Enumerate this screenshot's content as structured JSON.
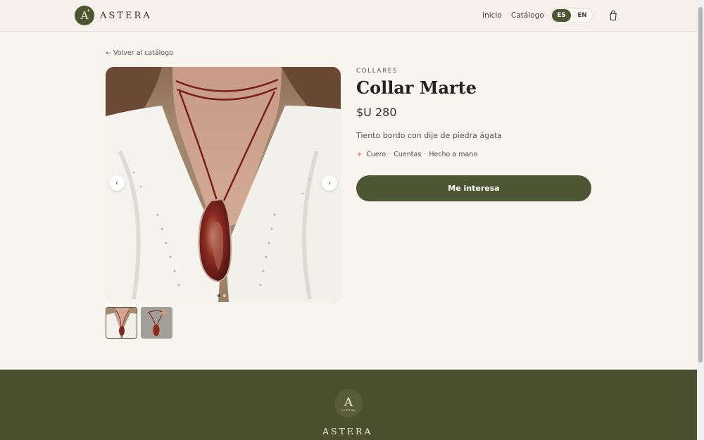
{
  "brand": {
    "name": "ASTERA",
    "logo_letter": "A",
    "footer_logo_small_text": "ASTERA"
  },
  "nav": {
    "inicio": "Inicio",
    "catalogo": "Catálogo"
  },
  "lang": {
    "es": "ES",
    "en": "EN",
    "selected": "ES"
  },
  "back_link": "← Volver al catálogo",
  "product": {
    "category": "COLLARES",
    "title": "Collar Marte",
    "price": "$U 280",
    "description": "Tiento bordo con dije de piedra ágata",
    "tags": [
      "Cuero",
      "Cuentas",
      "Hecho a mano"
    ],
    "cta": "Me interesa"
  },
  "carousel": {
    "prev": "‹",
    "next": "›",
    "slide_count": 2,
    "active_index": 0
  },
  "colors": {
    "accent": "#4d5632",
    "background": "#f8f5ee",
    "footer": "#4a5030",
    "tag_sparkle": "#d59a8c"
  },
  "icons": {
    "cart": "shopping-bag-icon",
    "tag": "sparkle-icon"
  }
}
